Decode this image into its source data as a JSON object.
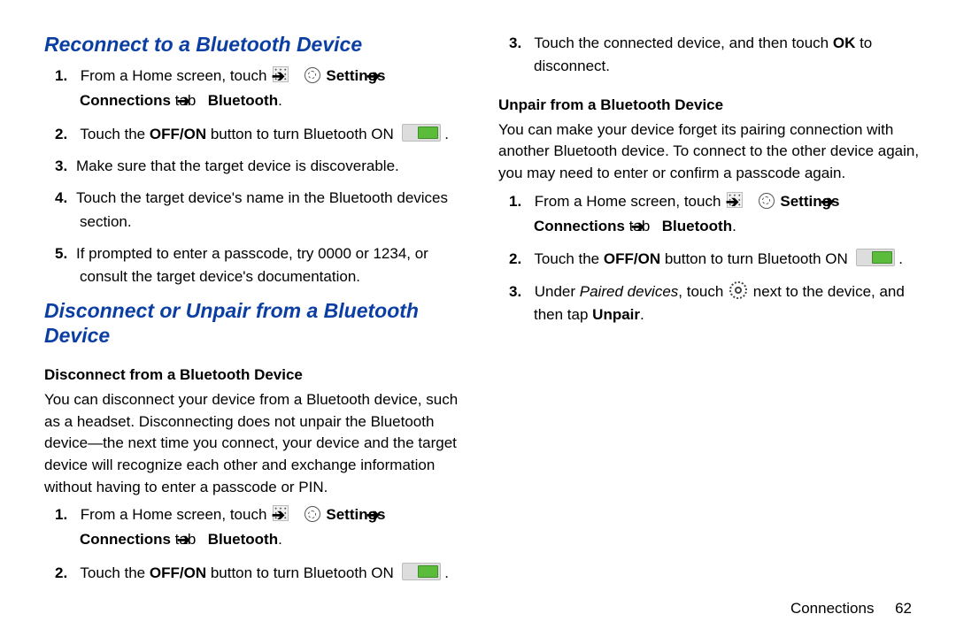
{
  "section1": {
    "title": "Reconnect to a Bluetooth Device",
    "steps": [
      {
        "pre": "From a Home screen, touch ",
        "mid_bold": "Settings",
        "post_bold1": "Connections",
        "post_plain1": " tab ",
        "post_bold2": "Bluetooth",
        "post_plain2": "."
      },
      {
        "pre": "Touch the ",
        "b1": "OFF/ON",
        "mid": " button to turn Bluetooth ON "
      },
      {
        "text": "Make sure that the target device is discoverable."
      },
      {
        "text": "Touch the target device's name in the Bluetooth devices section."
      },
      {
        "text": "If prompted to enter a passcode, try 0000 or 1234, or consult the target device's documentation."
      }
    ]
  },
  "section2": {
    "title": "Disconnect or Unpair from a Bluetooth Device",
    "sub1": "Disconnect from a Bluetooth Device",
    "para1": "You can disconnect your device from a Bluetooth device, such as a headset. Disconnecting does not unpair the Bluetooth device—the next time you connect, your device and the target device will recognize each other and exchange information without having to enter a passcode or PIN.",
    "steps1": [
      {
        "pre": "From a Home screen, touch ",
        "mid_bold": "Settings",
        "post_bold1": "Connections",
        "post_plain1": " tab ",
        "post_bold2": "Bluetooth",
        "post_plain2": "."
      },
      {
        "pre": "Touch the ",
        "b1": "OFF/ON",
        "mid": " button to turn Bluetooth ON "
      }
    ],
    "steps1_cont": [
      {
        "pre": "Touch the connected device, and then touch ",
        "b1": "OK",
        "post": " to disconnect."
      }
    ],
    "sub2": "Unpair from a Bluetooth Device",
    "para2": "You can make your device forget its pairing connection with another Bluetooth device. To connect to the other device again, you may need to enter or confirm a passcode again.",
    "steps2": [
      {
        "pre": "From a Home screen, touch ",
        "mid_bold": "Settings",
        "post_bold1": "Connections",
        "post_plain1": " tab ",
        "post_bold2": "Bluetooth",
        "post_plain2": "."
      },
      {
        "pre": "Touch the ",
        "b1": "OFF/ON",
        "mid": " button to turn Bluetooth ON "
      },
      {
        "pre": "Under ",
        "i1": "Paired devices",
        "mid": ", touch ",
        "post": " next to the device, and then tap ",
        "b2": "Unpair",
        "end": "."
      }
    ]
  },
  "footer": {
    "left": "Connections",
    "right": "62"
  }
}
